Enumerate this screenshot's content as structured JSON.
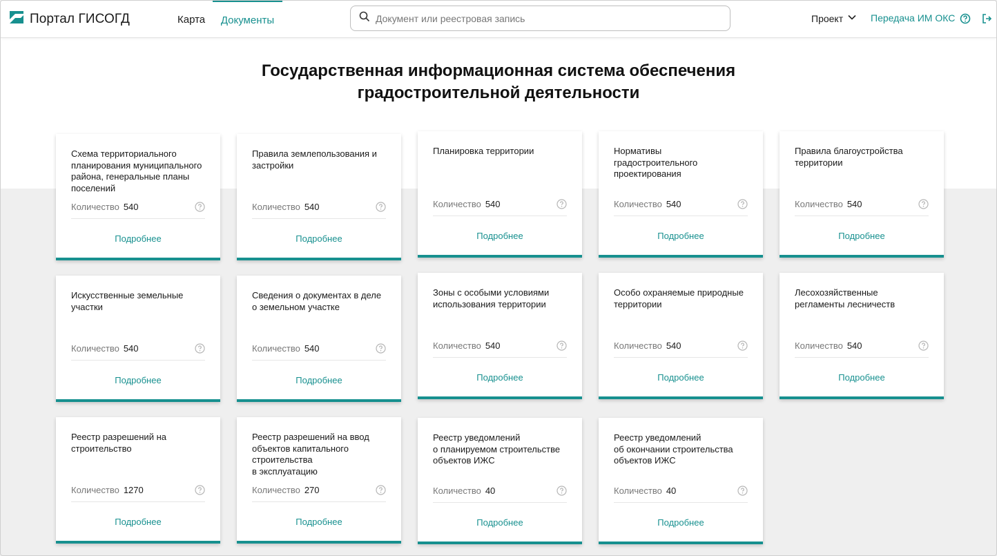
{
  "header": {
    "app_title": "Портал ГИСОГД",
    "nav": {
      "map": "Карта",
      "documents": "Документы"
    },
    "search_placeholder": "Документ или реестровая запись",
    "project_label": "Проект",
    "transfer_label": "Передача ИМ ОКС",
    "icons": [
      "logo-icon",
      "search-icon",
      "chevron-down-icon",
      "help-icon",
      "logout-icon"
    ]
  },
  "page_title_line1": "Государственная информационная система обеспечения",
  "page_title_line2": "градостроительной деятельности",
  "count_label": "Количество",
  "more_label": "Подробнее",
  "accent_color": "#17908f",
  "cards": [
    {
      "title": "Схема территориального\nпланирования муниципального\nрайона, генеральные планы\nпоселений",
      "count": "540"
    },
    {
      "title": "Правила землепользования и\nзастройки",
      "count": "540"
    },
    {
      "title": "Планировка территории",
      "count": "540"
    },
    {
      "title": "Нормативы\nградостроительного\nпроектирования",
      "count": "540"
    },
    {
      "title": "Правила благоустройства\nтерритории",
      "count": "540"
    },
    {
      "title": "Искусственные земельные\nучастки",
      "count": "540"
    },
    {
      "title": "Сведения о документах в деле\nо земельном участке",
      "count": "540"
    },
    {
      "title": "Зоны с особыми условиями\nиспользования территории",
      "count": "540"
    },
    {
      "title": "Особо охраняемые природные\nтерритории",
      "count": "540"
    },
    {
      "title": "Лесохозяйственные\nрегламенты лесничеств",
      "count": "540"
    },
    {
      "title": "Реестр разрешений на\nстроительство",
      "count": "1270"
    },
    {
      "title": "Реестр разрешений на ввод\nобъектов капитального\nстроительства\nв эксплуатацию",
      "count": "270"
    },
    {
      "title": "Реестр уведомлений\nо планируемом строительстве\nобъектов ИЖС",
      "count": "40"
    },
    {
      "title": "Реестр уведомлений\nоб окончании строительства\nобъектов ИЖС",
      "count": "40"
    }
  ]
}
